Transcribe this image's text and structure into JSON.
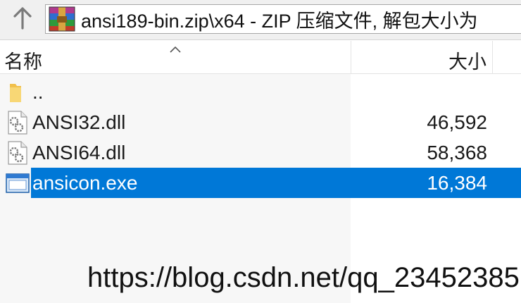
{
  "toolbar": {
    "up_icon": "up-arrow-icon",
    "archive_icon": "winrar-archive-icon",
    "address_text": "ansi189-bin.zip\\x64 - ZIP 压缩文件, 解包大小为"
  },
  "columns": {
    "name_label": "名称",
    "size_label": "大小",
    "sort_icon": "sort-ascending-icon"
  },
  "files": [
    {
      "name": "..",
      "size": "",
      "icon": "folder-icon"
    },
    {
      "name": "ANSI32.dll",
      "size": "46,592",
      "icon": "dll-gear-icon"
    },
    {
      "name": "ANSI64.dll",
      "size": "58,368",
      "icon": "dll-gear-icon"
    },
    {
      "name": "ansicon.exe",
      "size": "16,384",
      "icon": "exe-window-icon",
      "selected": true
    }
  ],
  "colors": {
    "selection": "#0078d7",
    "shade": "#f7f7f7"
  },
  "watermark": "https://blog.csdn.net/qq_23452385"
}
